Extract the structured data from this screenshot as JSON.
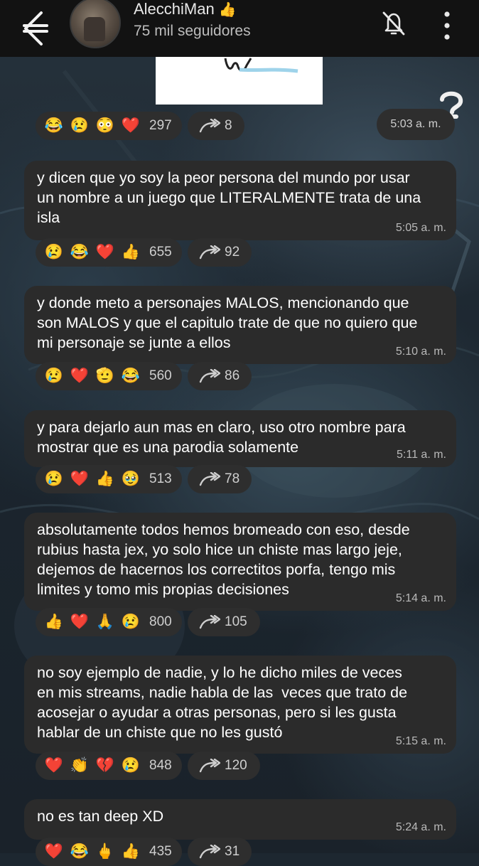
{
  "header": {
    "channel_name": "AlecchiMan",
    "name_emoji": "👍",
    "subscribers": "75 mil seguidores"
  },
  "colors": {
    "header_bg": "#121212",
    "bubble_bg": "#2b2b2b",
    "pill_bg": "#2e2e2e",
    "heart": "#e0284a"
  },
  "icons": {
    "back": "back-arrow-icon",
    "mute": "bell-off-icon",
    "more": "more-vertical-icon",
    "forward": "forward-arrow-icon"
  },
  "first_post": {
    "reactions": [
      "😂",
      "😢",
      "😳",
      "❤️"
    ],
    "reaction_count": "297",
    "forward_count": "8",
    "time": "5:03 a. m."
  },
  "messages": [
    {
      "text": "y dicen que yo soy la peor persona del mundo por usar\nun nombre a un juego que LITERALMENTE trata de una\nisla",
      "time": "5:05 a. m.",
      "reactions": [
        "😢",
        "😂",
        "❤️",
        "👍"
      ],
      "reaction_count": "655",
      "forward_count": "92"
    },
    {
      "text": "y donde meto a personajes MALOS, mencionando que\nson MALOS y que el capitulo trate de que no quiero que\nmi personaje se junte a ellos",
      "time": "5:10 a. m.",
      "reactions": [
        "😢",
        "❤️",
        "🫡",
        "😂"
      ],
      "reaction_count": "560",
      "forward_count": "86"
    },
    {
      "text": "y para dejarlo aun mas en claro, uso otro nombre para\nmostrar que es una parodia solamente",
      "time": "5:11 a. m.",
      "reactions": [
        "😢",
        "❤️",
        "👍",
        "🥹"
      ],
      "reaction_count": "513",
      "forward_count": "78"
    },
    {
      "text": "absolutamente todos hemos bromeado con eso, desde\nrubius hasta jex, yo solo hice un chiste mas largo jeje,\ndejemos de hacernos los correctitos porfa, tengo mis\nlimites y tomo mis propias decisiones",
      "time": "5:14 a. m.",
      "reactions": [
        "👍",
        "❤️",
        "🙏",
        "😢"
      ],
      "reaction_count": "800",
      "forward_count": "105"
    },
    {
      "text": "no soy ejemplo de nadie, y lo he dicho miles de veces\nen mis streams, nadie habla de las  veces que trato de\nacosejar o ayudar a otras personas, pero si les gusta\nhablar de un chiste que no les gustó",
      "time": "5:15 a. m.",
      "reactions": [
        "❤️",
        "👏",
        "💔",
        "😢"
      ],
      "reaction_count": "848",
      "forward_count": "120"
    },
    {
      "text": "no es tan deep XD",
      "time": "5:24 a. m.",
      "reactions": [
        "❤️",
        "😂",
        "🖕",
        "👍"
      ],
      "reaction_count": "435",
      "forward_count": "31"
    }
  ]
}
